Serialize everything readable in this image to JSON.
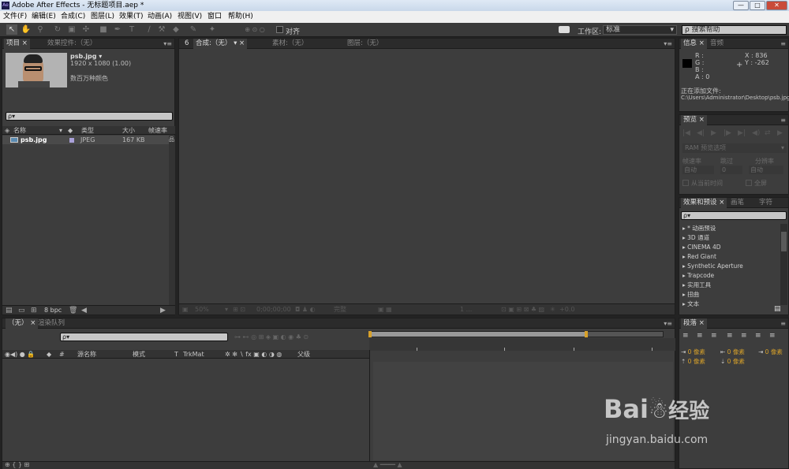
{
  "window": {
    "title": "Adobe After Effects - 无标题项目.aep *",
    "logo": "Ae",
    "min_label": "—",
    "max_label": "□",
    "close_label": "✕"
  },
  "menu": [
    "文件(F)",
    "编辑(E)",
    "合成(C)",
    "图层(L)",
    "效果(T)",
    "动画(A)",
    "视图(V)",
    "窗口",
    "帮助(H)"
  ],
  "toolbar": {
    "snap_label": "对齐",
    "workspace_label": "工作区:",
    "workspace_value": "标准",
    "search_placeholder": "搜索帮助"
  },
  "project": {
    "tab_project": "项目",
    "tab_effects_controls": "效果控件:（无）",
    "file_name": "psb.jpg ▾",
    "file_dims": "1920 x 1080 (1.00)",
    "file_colors": "数百万种颜色",
    "search_value": "ρ▾",
    "columns": {
      "name": "名称",
      "type": "类型",
      "size": "大小",
      "fps": "帧速率"
    },
    "items": [
      {
        "name": "psb.jpg",
        "type": "JPEG",
        "size": "167 KB"
      }
    ],
    "bpc": "8 bpc"
  },
  "viewer": {
    "tab_comp": "合成:（无）",
    "tab_footage": "素材:（无）",
    "tab_layer": "图层:（无）",
    "zoom": "50%",
    "timecode": "0;00;00;00",
    "quality": "完整",
    "exposure": "+0.0"
  },
  "info": {
    "tab_info": "信息",
    "tab_audio": "音频",
    "r": "R :",
    "g": "G :",
    "b": "B :",
    "a": "A : 0",
    "x": "X : 836",
    "y": "Y : -262",
    "adding_label": "正在添加文件:",
    "adding_path": "C:\\Users\\Administrator\\Desktop\\psb.jpg"
  },
  "preview": {
    "tab": "预览",
    "ram_options": "RAM 预览选项",
    "fps_label": "帧速率",
    "skip_label": "跳过",
    "res_label": "分辨率",
    "fps_value": "自动",
    "skip_value": "0",
    "res_value": "自动",
    "from_current": "从当前时间",
    "fullscreen": "全屏"
  },
  "effects": {
    "tab": "效果和预设",
    "tab_brush": "画笔",
    "tab_char": "字符",
    "search_value": "ρ▾",
    "items": [
      "* 动画预设",
      "3D 通道",
      "CINEMA 4D",
      "Red Giant",
      "Synthetic Aperture",
      "Trapcode",
      "实用工具",
      "扭曲",
      "文本"
    ]
  },
  "paragraph": {
    "tab": "段落",
    "indent_values": [
      "0 像素",
      "0 像素",
      "0 像素",
      "0 像素",
      "0 像素"
    ]
  },
  "timeline": {
    "tab_none": "（无）",
    "tab_render": "渲染队列",
    "search_value": "ρ▾",
    "col_num": "#",
    "col_source": "源名称",
    "col_mode": "模式",
    "col_t": "T",
    "col_trkmat": "TrkMat",
    "col_parent": "父级"
  },
  "watermark": {
    "brand": "Bai",
    "brand2": "经验",
    "url": "jingyan.baidu.com"
  }
}
